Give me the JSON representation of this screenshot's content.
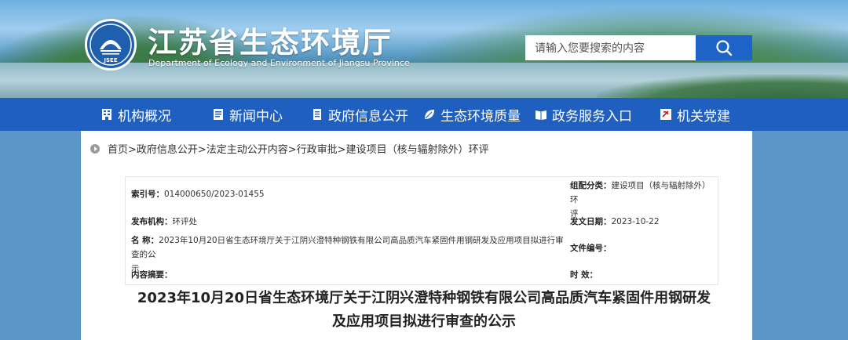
{
  "header": {
    "site_title": "江苏省生态环境厅",
    "site_subtitle": "Department of Ecology and Environment of Jiangsu Province",
    "logo_text": "JSEE",
    "search_placeholder": "请输入您要搜索的内容"
  },
  "nav": {
    "items": [
      {
        "label": "机构概况",
        "icon": "building-icon"
      },
      {
        "label": "新闻中心",
        "icon": "news-icon"
      },
      {
        "label": "政府信息公开",
        "icon": "document-icon"
      },
      {
        "label": "生态环境质量",
        "icon": "leaf-icon"
      },
      {
        "label": "政务服务入口",
        "icon": "book-icon"
      },
      {
        "label": "机关党建",
        "icon": "party-emblem-icon"
      }
    ]
  },
  "breadcrumb": "首页>政府信息公开>法定主动公开内容>行政审批>建设项目（核与辐射除外）环评",
  "meta": {
    "index_label": "索引号：",
    "index_value": "014000650/2023-01455",
    "category_label": "组配分类：",
    "category_value_line1": "建设项目（核与辐射除外）环",
    "category_value_line2": "评",
    "publisher_label": "发布机构：",
    "publisher_value": "环评处",
    "date_label": "发文日期：",
    "date_value": "2023-10-22",
    "name_label": "名 称：",
    "name_value_line1": "2023年10月20日省生态环境厅关于江阴兴澄特种钢铁有限公司高品质汽车紧固件用钢研发及应用项目拟进行审查的公",
    "name_value_line2": "示",
    "doc_no_label": "文件编号：",
    "summary_label": "内容摘要：",
    "validity_label": "时 效："
  },
  "article": {
    "title_line1": "2023年10月20日省生态环境厅关于江阴兴澄特种钢铁有限公司高品质汽车紧固件用钢研发",
    "title_line2": "及应用项目拟进行审查的公示"
  },
  "colors": {
    "nav_bg": "#1e5fbf",
    "search_button": "#1e63c8",
    "page_bg": "#5a96c8"
  }
}
